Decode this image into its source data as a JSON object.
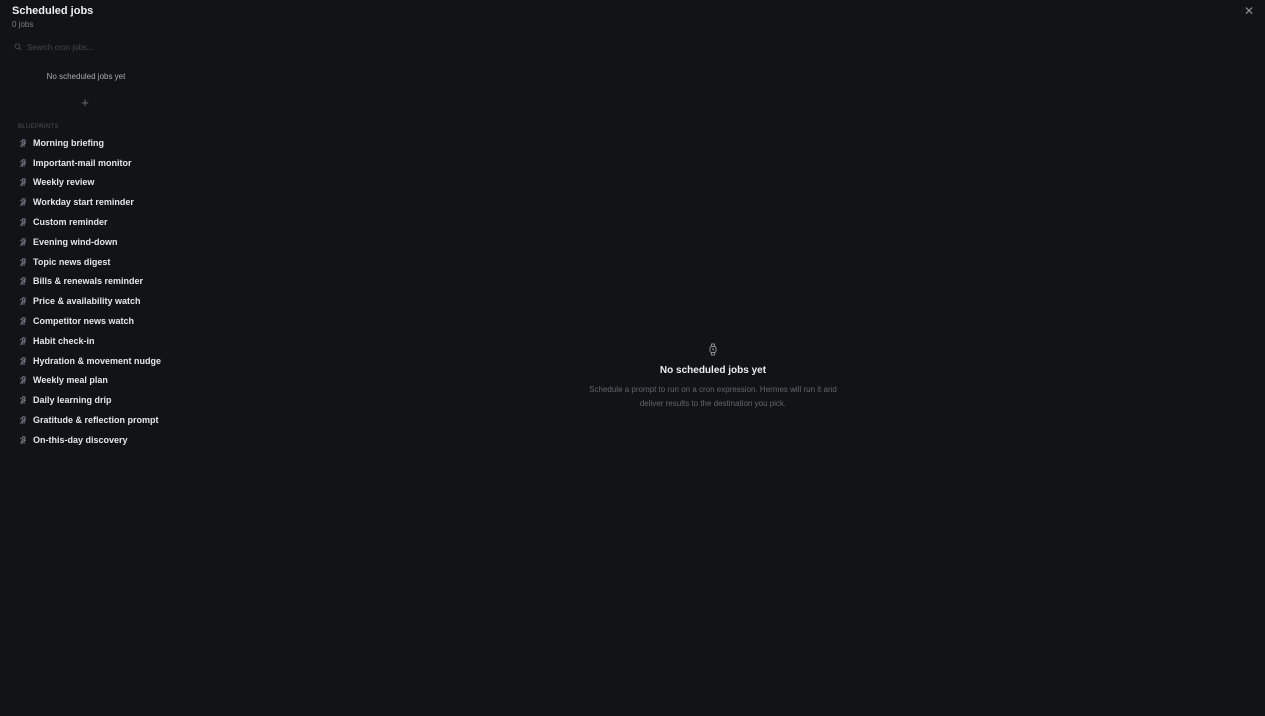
{
  "header": {
    "title": "Scheduled jobs",
    "job_count": "0 jobs",
    "close_icon": "close-icon"
  },
  "sidebar": {
    "search": {
      "placeholder": "Search cron jobs..."
    },
    "jobs_empty_text": "No scheduled jobs yet",
    "add_icon": "+",
    "section_label": "Blueprints",
    "blueprints": [
      {
        "label": "Morning briefing"
      },
      {
        "label": "Important-mail monitor"
      },
      {
        "label": "Weekly review"
      },
      {
        "label": "Workday start reminder"
      },
      {
        "label": "Custom reminder"
      },
      {
        "label": "Evening wind-down"
      },
      {
        "label": "Topic news digest"
      },
      {
        "label": "Bills & renewals reminder"
      },
      {
        "label": "Price & availability watch"
      },
      {
        "label": "Competitor news watch"
      },
      {
        "label": "Habit check-in"
      },
      {
        "label": "Hydration & movement nudge"
      },
      {
        "label": "Weekly meal plan"
      },
      {
        "label": "Daily learning drip"
      },
      {
        "label": "Gratitude & reflection prompt"
      },
      {
        "label": "On-this-day discovery"
      }
    ]
  },
  "main": {
    "empty_icon": "watch-icon",
    "empty_title": "No scheduled jobs yet",
    "empty_description": "Schedule a prompt to run on a cron expression. Hermes will run it and deliver results to the destination you pick."
  },
  "colors": {
    "background": "#121316",
    "text_primary": "#e4e6e8",
    "text_muted": "#62656b"
  }
}
